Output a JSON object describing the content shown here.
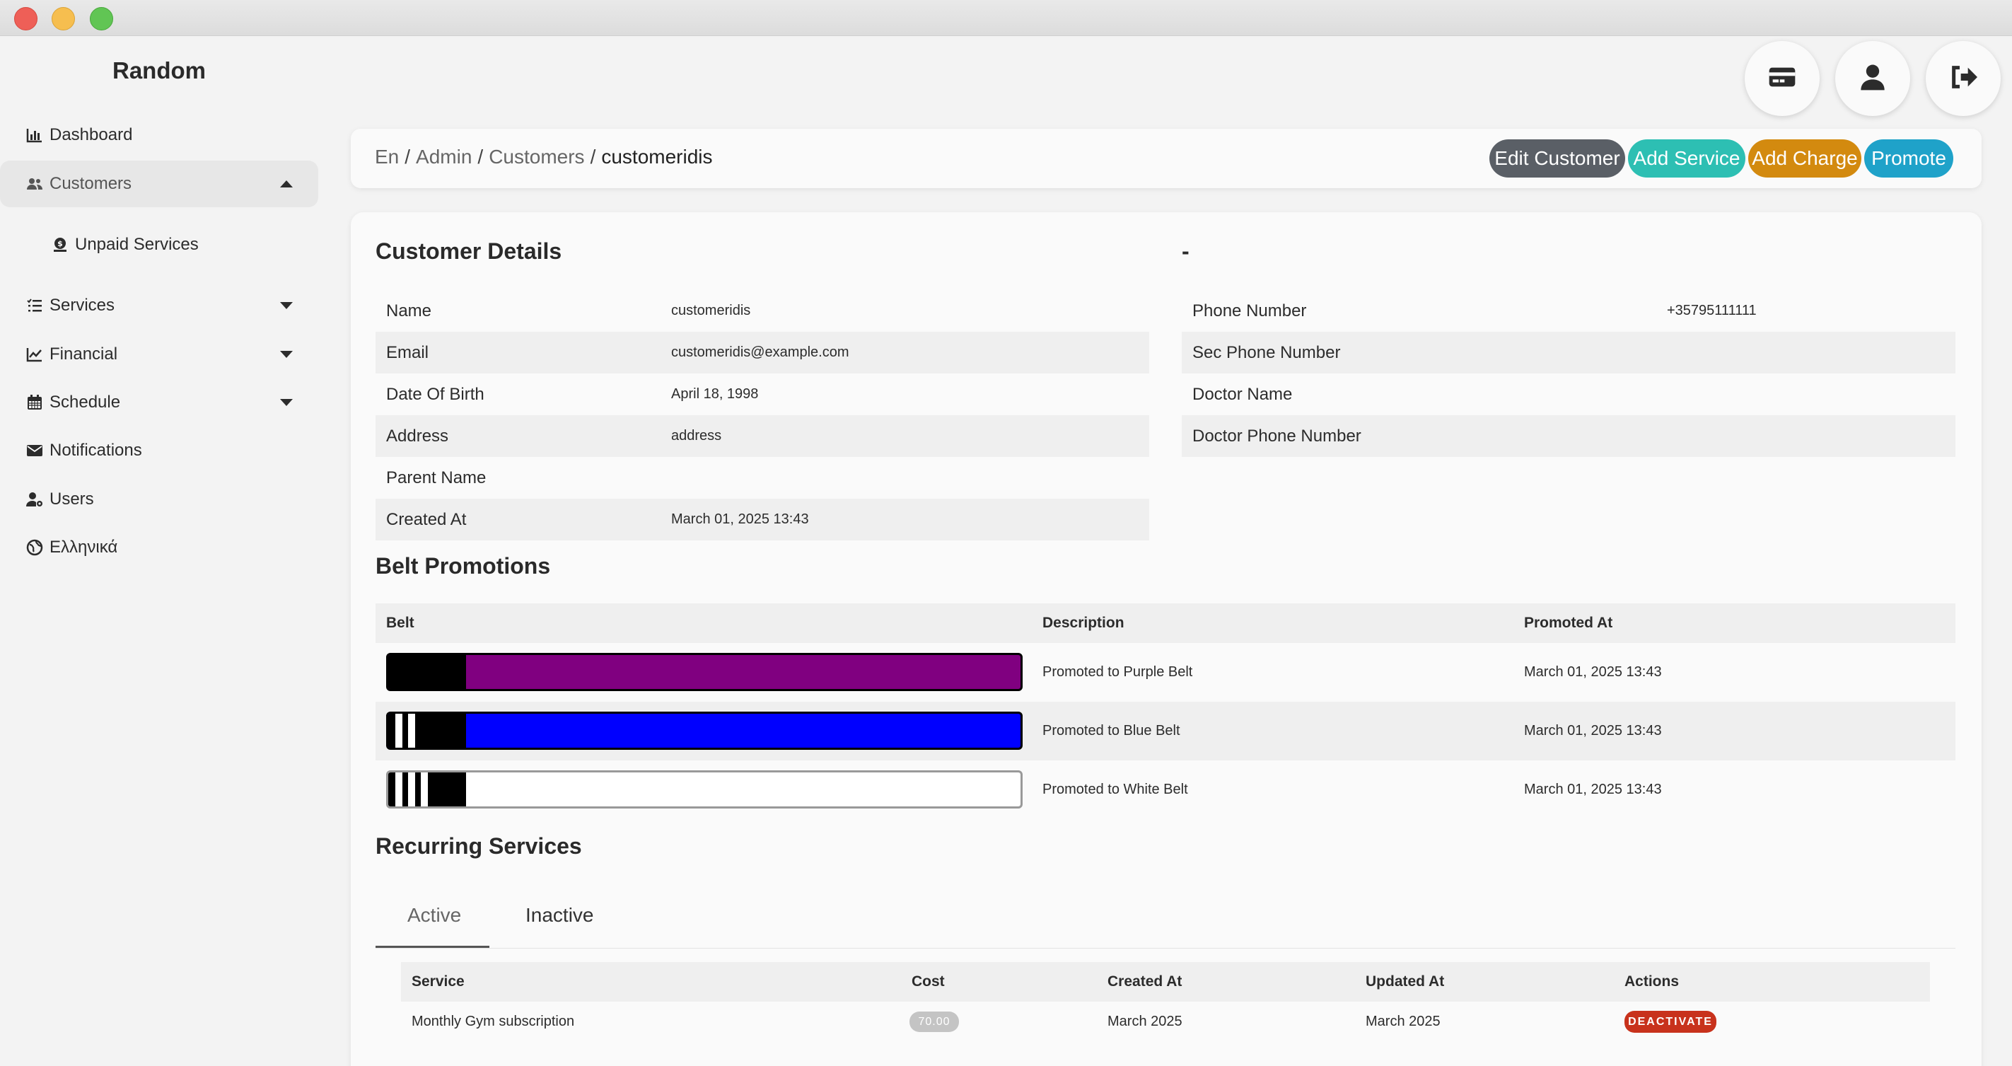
{
  "sidebar": {
    "brand": "Random",
    "items": [
      {
        "label": "Dashboard",
        "icon": "chart-icon"
      },
      {
        "label": "Customers",
        "icon": "users-icon"
      },
      {
        "label": "Unpaid Services",
        "icon": "money-icon"
      },
      {
        "label": "Services",
        "icon": "list-icon"
      },
      {
        "label": "Financial",
        "icon": "line-chart-icon"
      },
      {
        "label": "Schedule",
        "icon": "calendar-icon"
      },
      {
        "label": "Notifications",
        "icon": "envelope-icon"
      },
      {
        "label": "Users",
        "icon": "user-gear-icon"
      },
      {
        "label": "Ελληνικά",
        "icon": "globe-icon"
      }
    ]
  },
  "topbar": {
    "buttons": [
      "credit-card-icon",
      "user-icon",
      "logout-icon"
    ]
  },
  "breadcrumb": {
    "lang": "En",
    "admin": "Admin",
    "customers": "Customers",
    "current": "customeridis",
    "separator": "/"
  },
  "actions": {
    "edit": "Edit Customer",
    "add_service": "Add Service",
    "add_charge": "Add Charge",
    "promote": "Promote"
  },
  "colors": {
    "edit": "#5a5f66",
    "add_service": "#2dbfb3",
    "add_charge": "#d38a0f",
    "promote": "#1fa2c9",
    "deactivate": "#c8321c"
  },
  "details": {
    "title": "Customer Details",
    "right_title": "-",
    "left": [
      {
        "label": "Name",
        "value": "customeridis"
      },
      {
        "label": "Email",
        "value": "customeridis@example.com"
      },
      {
        "label": "Date Of Birth",
        "value": "April 18, 1998"
      },
      {
        "label": "Address",
        "value": "address"
      },
      {
        "label": "Parent Name",
        "value": ""
      },
      {
        "label": "Created At",
        "value": "March 01, 2025 13:43"
      }
    ],
    "right": [
      {
        "label": "Phone Number",
        "value": "+35795111111"
      },
      {
        "label": "Sec Phone Number",
        "value": ""
      },
      {
        "label": "Doctor Name",
        "value": ""
      },
      {
        "label": "Doctor Phone Number",
        "value": ""
      }
    ]
  },
  "belts": {
    "title": "Belt Promotions",
    "headers": [
      "Belt",
      "Description",
      "Promoted At"
    ],
    "rows": [
      {
        "color": "#800080",
        "stripes": 0,
        "description": "Promoted to Purple Belt",
        "promoted_at": "March 01, 2025 13:43"
      },
      {
        "color": "#0000ff",
        "stripes": 2,
        "description": "Promoted to Blue Belt",
        "promoted_at": "March 01, 2025 13:43"
      },
      {
        "color": "#ffffff",
        "stripes": 3,
        "description": "Promoted to White Belt",
        "promoted_at": "March 01, 2025 13:43"
      }
    ]
  },
  "recurring": {
    "title": "Recurring Services",
    "tabs": [
      "Active",
      "Inactive"
    ],
    "headers": [
      "Service",
      "Cost",
      "Created At",
      "Updated At",
      "Actions"
    ],
    "rows": [
      {
        "service": "Monthly Gym subscription",
        "cost": "70.00",
        "created": "March 2025",
        "updated": "March 2025",
        "action": "DEACTIVATE"
      }
    ]
  }
}
